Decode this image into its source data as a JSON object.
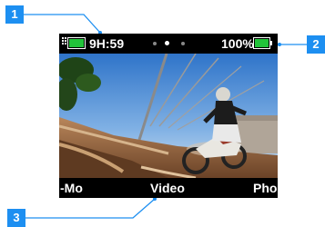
{
  "callouts": [
    "1",
    "2",
    "3"
  ],
  "status_bar": {
    "time_remaining": "9H:59",
    "battery_percent": "100%",
    "page_dots": 3,
    "active_dot": 1,
    "battery_color": "#22c43a"
  },
  "mode_bar": {
    "left_mode": "-Mo",
    "current_mode": "Video",
    "right_mode": "Pho"
  },
  "accent_color": "#1d8ff1"
}
